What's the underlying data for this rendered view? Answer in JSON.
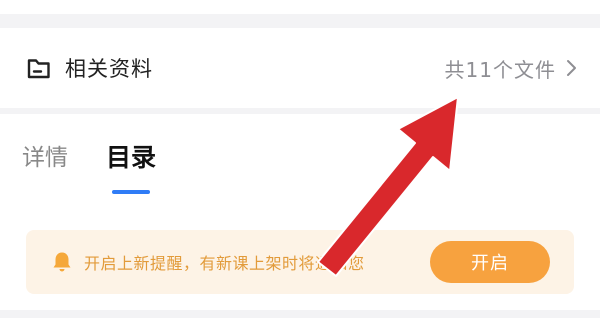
{
  "materials": {
    "title": "相关资料",
    "count_label": "共11个文件",
    "icon": "folder-icon",
    "chevron": "chevron-right-icon"
  },
  "tabs": [
    {
      "label": "详情",
      "active": false
    },
    {
      "label": "目录",
      "active": true
    }
  ],
  "notify": {
    "text": "开启上新提醒，有新课上架时将通知您",
    "button_label": "开启",
    "icon": "bell-icon"
  },
  "colors": {
    "accent_blue": "#2f7cf6",
    "notify_bg": "#fdf3e6",
    "notify_text": "#e29b3a",
    "button_orange": "#f7a23f",
    "arrow_red": "#d9282c"
  }
}
